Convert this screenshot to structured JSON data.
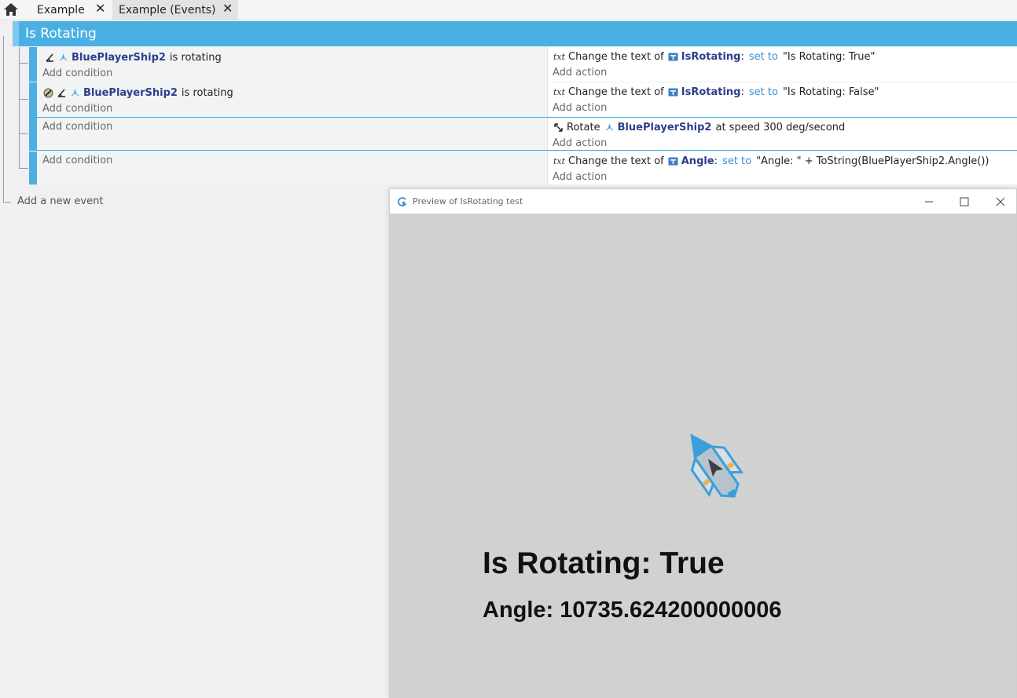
{
  "tabs": [
    {
      "label": "Example",
      "close": "✕"
    },
    {
      "label": "Example (Events)",
      "close": "✕"
    }
  ],
  "group": {
    "title": "Is Rotating"
  },
  "events": [
    {
      "condition": {
        "object": "BluePlayerShip2",
        "text": "is rotating"
      },
      "add_condition": "Add condition",
      "action": {
        "prefix": "Change the text of",
        "object": "IsRotating",
        "op": "set to",
        "value": "\"Is Rotating: True\""
      },
      "add_action": "Add action"
    },
    {
      "condition": {
        "object": "BluePlayerShip2",
        "text": "is rotating"
      },
      "add_condition": "Add condition",
      "action": {
        "prefix": "Change the text of",
        "object": "IsRotating",
        "op": "set to",
        "value": "\"Is Rotating: False\""
      },
      "add_action": "Add action"
    },
    {
      "add_condition": "Add condition",
      "action": {
        "prefix": "Rotate",
        "object": "BluePlayerShip2",
        "suffix": "at speed 300 deg/second"
      },
      "add_action": "Add action"
    },
    {
      "add_condition": "Add condition",
      "action": {
        "prefix": "Change the text of",
        "object": "Angle",
        "op": "set to",
        "value": "\"Angle: \" + ToString(BluePlayerShip2.Angle())"
      },
      "add_action": "Add action"
    }
  ],
  "add_event": "Add a new event",
  "preview": {
    "title": "Preview of IsRotating test",
    "rotating_text": "Is Rotating: True",
    "angle_text": "Angle: 10735.624200000006"
  },
  "icons": {
    "home": "home-icon",
    "angle": "angle-icon",
    "ship": "ship-icon",
    "invert": "invert-icon",
    "text": "txt",
    "rotate": "rotate-icon",
    "text_object": "text-object-icon"
  },
  "colors": {
    "accent": "#4ab0e4",
    "object": "#2d3e8c",
    "setto": "#3a8fd6",
    "canvas": "#d0d1d1"
  }
}
